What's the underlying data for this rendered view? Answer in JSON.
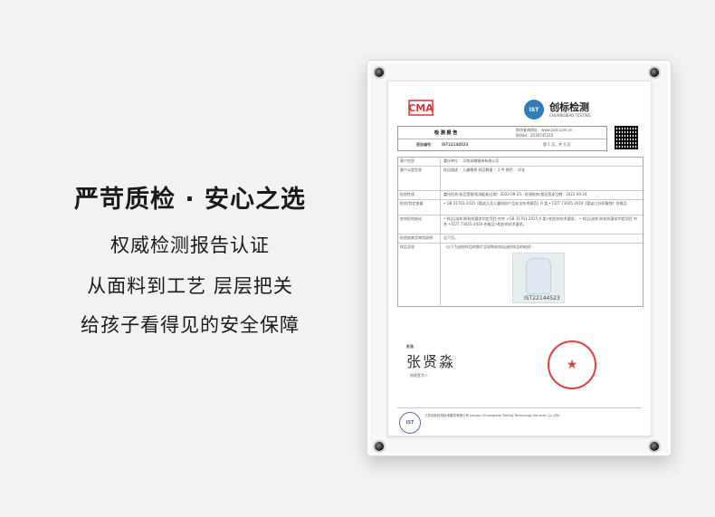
{
  "slogans": {
    "main": "严苛质检 · 安心之选",
    "line1": "权威检测报告认证",
    "line2": "从面料到工艺    层层把关",
    "line3": "给孩子看得见的安全保障"
  },
  "report": {
    "lab_logo_text": "CMA",
    "company_name": "创标检测",
    "company_en": "CHUANGBIAO TESTING",
    "title": "检 测 报 告",
    "report_no_label": "报告编号：",
    "report_no": "IST22144523",
    "query_site": "防伪查询网址：www.jsist.com.cn",
    "code": "防伪码：2530745115",
    "page": "第 1 页，共 4 页",
    "rows": [
      {
        "label": "客户信息",
        "value": "委托单位    ：河南米嘟服饰有限公司"
      },
      {
        "label": "客户认定信息",
        "value": "样品描述 ：儿童睡袋  样品数量 ：1 件  颜色 ：印花"
      },
      {
        "label": "检验性质",
        "value": "委托检测   样品受理/检测起始日期：2022-09-23，检测结束/报告签发日期：2022-09-24"
      },
      {
        "label": "检验/判定依据",
        "value": "• GB 31701-2015《婴幼儿及儿童纺织产品安全技术规范》A 类  • FZ/T 73025-2019《婴幼儿针织服饰》合格品"
      },
      {
        "label": "综合检验结论",
        "value": "• 样品[送样]所检所要求判定项目 符合 <GB 31701-2015 A 类>相应的技术要求。 • 样品[送样]所检所要求判定项目 符合 <FZ/T 73025-2019 合格品>相应的技术要求。"
      },
      {
        "label": "检验结果及审用说明",
        "value": "见下页。"
      },
      {
        "label": "样品呈现",
        "value": "（以下为送检样品的照片呈现和成衣自送检样品的粘样）"
      }
    ],
    "sample_id": "IST22144523",
    "approve_label": "批准",
    "signer_label": "授权签字人",
    "footer_text": "江苏创标检测技术服务有限公司 Jiangsu Chuangbiao Testing Technology Services Co.,LTD."
  }
}
